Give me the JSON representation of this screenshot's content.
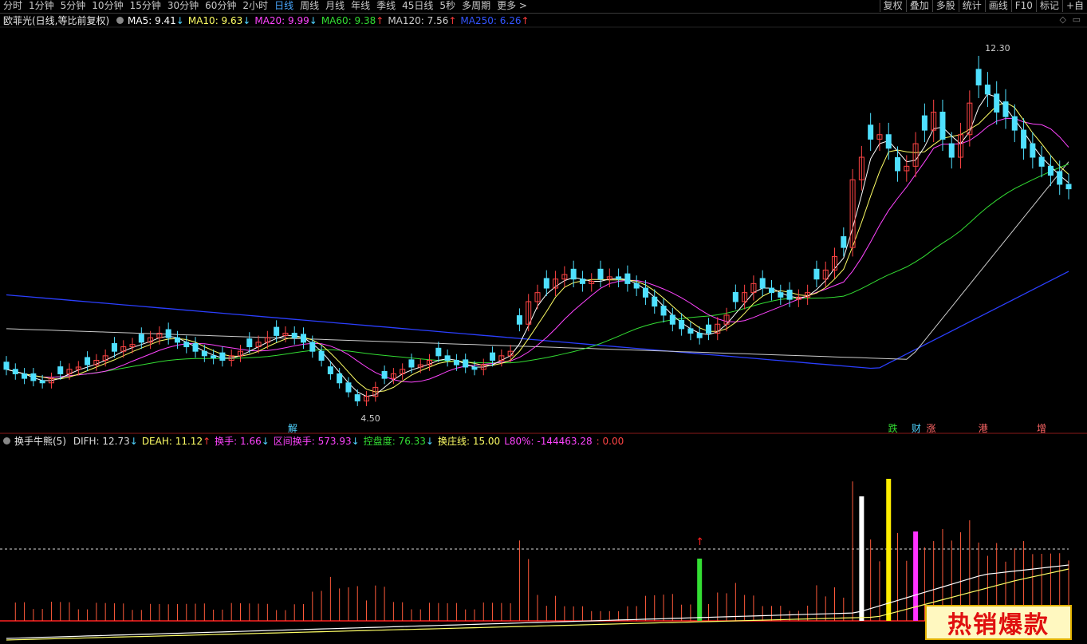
{
  "toolbar": {
    "periods": [
      "分时",
      "1分钟",
      "5分钟",
      "10分钟",
      "15分钟",
      "30分钟",
      "60分钟",
      "2小时",
      "日线",
      "周线",
      "月线",
      "年线",
      "季线",
      "45日线",
      "5秒",
      "多周期",
      "更多 >"
    ],
    "active_period": "日线",
    "right_buttons": [
      "复权",
      "叠加",
      "多股",
      "统计",
      "画线",
      "F10",
      "标记",
      "+自"
    ]
  },
  "main_legend": {
    "title": "欧菲光(日线,等比前复权)",
    "items": [
      {
        "label": "MA5: 9.41",
        "arrow": "↓",
        "color": "#ffffff"
      },
      {
        "label": "MA10: 9.63",
        "arrow": "↓",
        "color": "#ffff66"
      },
      {
        "label": "MA20: 9.99",
        "arrow": "↓",
        "color": "#ff44ff"
      },
      {
        "label": "MA60: 9.38",
        "arrow": "↑",
        "color": "#33dd33"
      },
      {
        "label": "MA120: 7.56",
        "arrow": "↑",
        "color": "#cccccc"
      },
      {
        "label": "MA250: 6.26",
        "arrow": "↑",
        "color": "#3355ff"
      }
    ]
  },
  "indicator_legend": {
    "title": "换手牛熊(5)",
    "items": [
      {
        "label": "DIFH: 12.73",
        "arrow": "↓",
        "color": "#dddddd"
      },
      {
        "label": "DEAH: 11.12",
        "arrow": "↑",
        "color": "#ffff66"
      },
      {
        "label": "换手: 1.66",
        "arrow": "↓",
        "color": "#ff44ff"
      },
      {
        "label": "区间换手: 573.93",
        "arrow": "↓",
        "color": "#ff44ff"
      },
      {
        "label": "控盘度: 76.33",
        "arrow": "↓",
        "color": "#33dd33"
      },
      {
        "label": "换庄线: 15.00",
        "arrow": "",
        "color": "#ffff66"
      },
      {
        "label": "L80%: -144463.28",
        "arrow": "",
        "color": "#ff44ff"
      },
      {
        "label": ": 0.00",
        "arrow": "",
        "color": "#ff4444"
      }
    ]
  },
  "markers": [
    {
      "text": "解",
      "color": "#4fd3ff"
    },
    {
      "text": "跌",
      "color": "#33dd33"
    },
    {
      "text": "财",
      "color": "#4fd3ff"
    },
    {
      "text": "涨",
      "color": "#ff6666"
    },
    {
      "text": "港",
      "color": "#ff6666"
    },
    {
      "text": "增",
      "color": "#ff6666"
    }
  ],
  "promo": {
    "text": "热销爆款"
  },
  "chart_data": {
    "type": "candlestick",
    "title": "欧菲光(日线,等比前复权)",
    "price_annotations": {
      "high": "12.30",
      "low": "4.50"
    },
    "ylim": [
      4.2,
      12.6
    ],
    "close": [
      5.3,
      5.2,
      5.1,
      5.05,
      5.0,
      5.1,
      5.2,
      5.3,
      5.35,
      5.4,
      5.5,
      5.6,
      5.7,
      5.8,
      5.85,
      5.9,
      6.0,
      6.1,
      6.0,
      5.9,
      5.8,
      5.7,
      5.6,
      5.55,
      5.5,
      5.6,
      5.7,
      5.8,
      5.9,
      6.0,
      6.05,
      6.1,
      6.0,
      5.9,
      5.7,
      5.5,
      5.2,
      5.0,
      4.8,
      4.6,
      4.7,
      4.9,
      5.1,
      5.2,
      5.3,
      5.35,
      5.4,
      5.5,
      5.6,
      5.5,
      5.4,
      5.35,
      5.3,
      5.4,
      5.5,
      5.6,
      5.7,
      6.3,
      6.8,
      7.0,
      7.1,
      7.3,
      7.4,
      7.3,
      7.2,
      7.25,
      7.3,
      7.35,
      7.3,
      7.2,
      7.1,
      6.9,
      6.7,
      6.5,
      6.3,
      6.2,
      6.1,
      6.0,
      6.1,
      6.3,
      6.5,
      6.8,
      7.0,
      7.2,
      7.1,
      7.0,
      6.9,
      6.85,
      6.9,
      7.0,
      7.3,
      7.5,
      7.8,
      8.0,
      9.5,
      10.0,
      10.4,
      10.5,
      10.2,
      9.7,
      9.8,
      10.3,
      10.6,
      11.0,
      10.4,
      10.0,
      10.5,
      11.2,
      11.6,
      11.4,
      11.0,
      10.9,
      10.6,
      10.2,
      10.0,
      9.8,
      9.6,
      9.4,
      9.3
    ],
    "macd": {
      "DIFH": 12.73,
      "DEAH": 11.12
    },
    "turnover": {
      "换手": 1.66,
      "区间换手": 573.93,
      "控盘度": 76.33,
      "换庄线": 15.0,
      "L80%": -144463.28
    }
  }
}
